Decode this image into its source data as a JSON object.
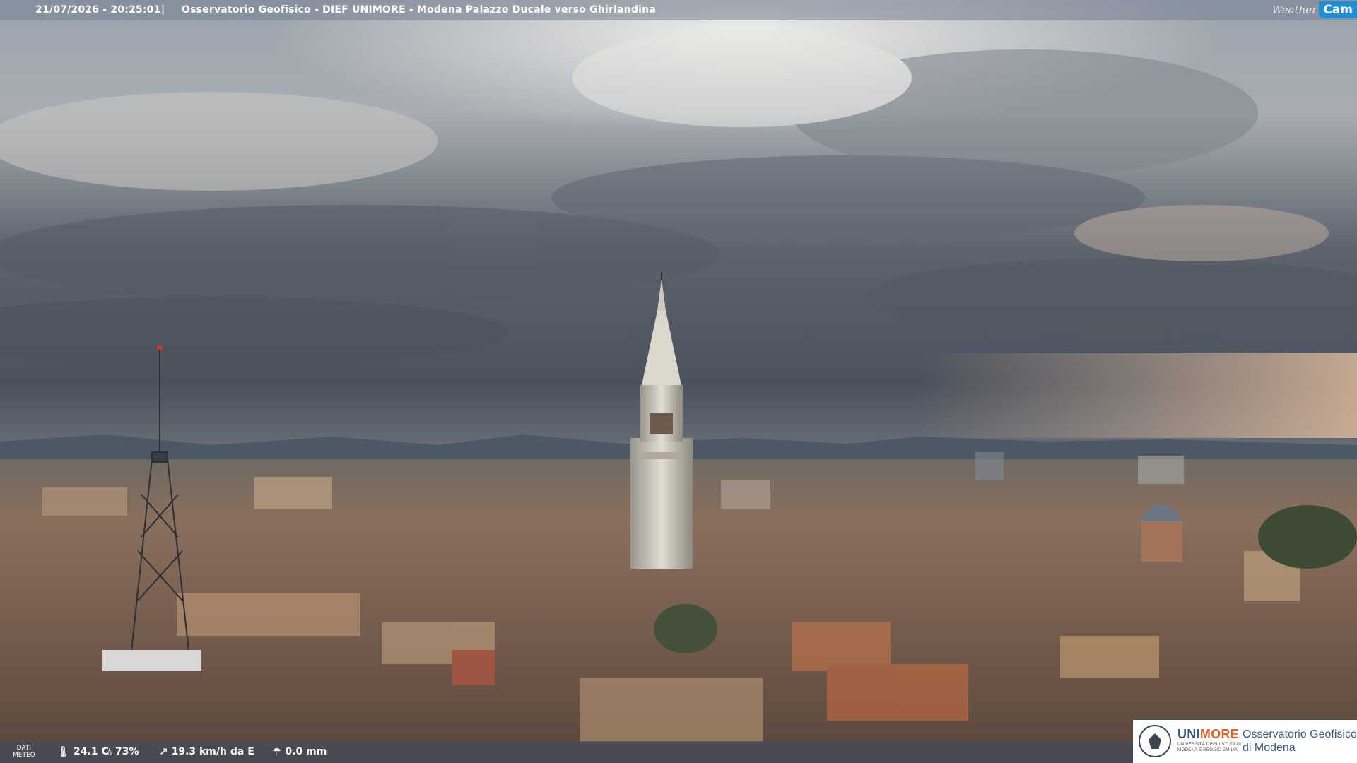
{
  "header": {
    "timestamp": "21/07/2026 - 20:25:01",
    "separator": "|",
    "title": "Osservatorio Geofisico - DIEF UNIMORE - Modena Palazzo Ducale verso Ghirlandina"
  },
  "brand": {
    "weather": "Weather",
    "cam": "Cam"
  },
  "meteo": {
    "label_line1": "DATI",
    "label_line2": "METEO",
    "temperature": "24.1 C",
    "temperature_icon": "thermometer-icon",
    "humidity": "73%",
    "humidity_icon": "droplet-icon",
    "wind": "19.3 km/h da E",
    "wind_icon": "wind-icon",
    "rain": "0.0 mm",
    "rain_icon": "rain-icon"
  },
  "logo": {
    "uni_part1": "UNI",
    "uni_part2": "MORE",
    "uni_sub_line1": "UNIVERSITÀ DEGLI STUDI DI",
    "uni_sub_line2": "MODENA E REGGIO EMILIA",
    "observatory_line1": "Osservatorio Geofisico",
    "observatory_line2": "di Modena"
  },
  "colors": {
    "cam_blue": "#1e8fd6",
    "unimore_blue": "#3b5a83",
    "unimore_orange": "#e3612b"
  }
}
